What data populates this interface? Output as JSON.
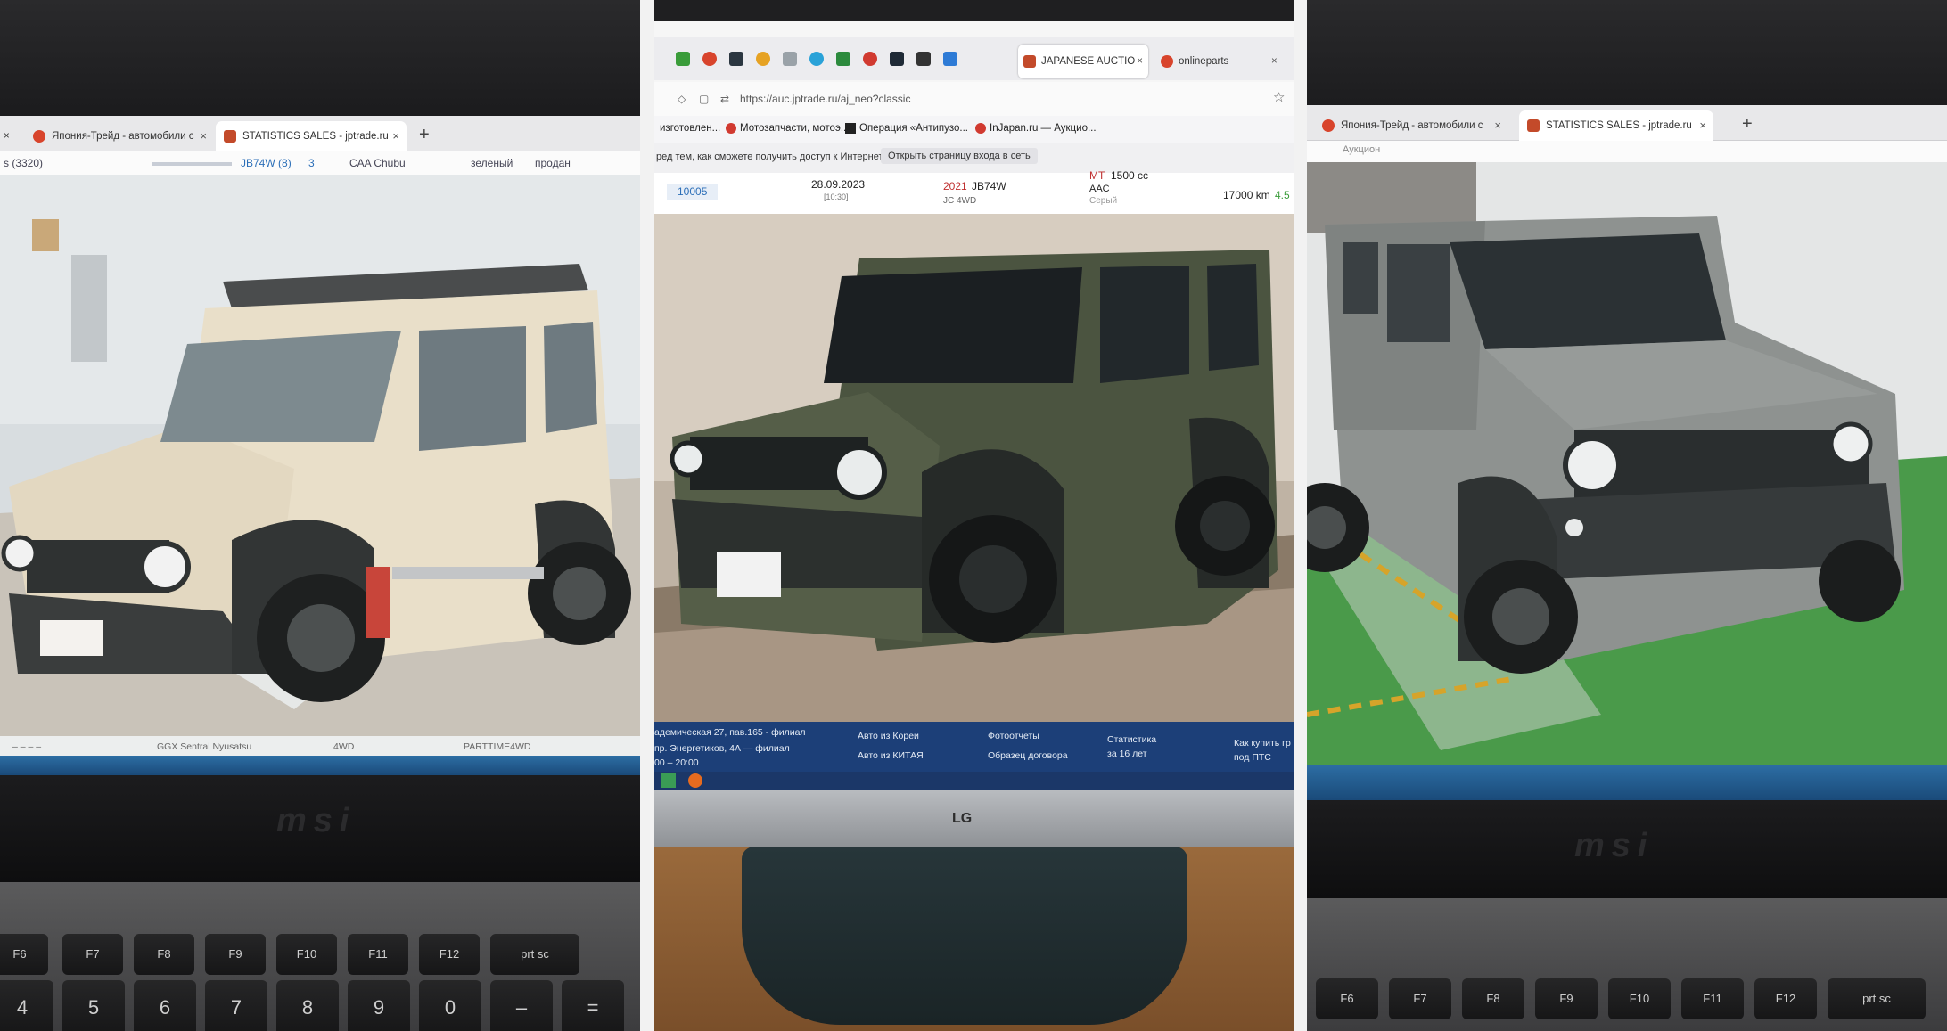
{
  "left": {
    "tabs": [
      {
        "label": "Япония-Трейд - автомобили с",
        "close": "×"
      },
      {
        "label": "STATISTICS SALES - jptrade.ru",
        "close": "×"
      }
    ],
    "new_tab": "+",
    "close_left": "×",
    "info": {
      "count": "s (3320)",
      "model": "JB74W",
      "model_count": "(8)",
      "page": "3",
      "auction": "CAA Chubu",
      "color": "зеленый",
      "status": "продан"
    },
    "footer": {
      "auction": "GGX Sentral Nyusatsu",
      "drive": "4WD",
      "transmission": "PARTTIME4WD",
      "dashes": "– – – –"
    },
    "brand": "msi",
    "keys": [
      "F6",
      "F7",
      "F8",
      "F9",
      "F10",
      "F11",
      "F12",
      "prt sc",
      "$",
      "4",
      "%",
      "5",
      "^",
      "6",
      "&",
      "7",
      "*",
      "8",
      "(",
      "9",
      ")",
      "0",
      "_",
      "–",
      "+",
      "="
    ]
  },
  "middle": {
    "browser": {
      "tab_active": "JAPANESE AUCTIO",
      "tab_other": "onlineparts",
      "url": "https://auc.jptrade.ru/aj_neo?classic",
      "bookmarks": [
        "изготовлен...",
        "Мотозапчасти, мотоэ...",
        "Операция «Антипузо...",
        "InJapan.ru — Аукцио..."
      ],
      "notice": "ред тем, как сможете получить доступ к Интернету.",
      "notice_button": "Открыть страницу входа в сеть"
    },
    "lot": {
      "number": "10005",
      "date": "28.09.2023",
      "time": "[10:30]",
      "year": "2021",
      "model": "JB74W",
      "grade": "JC 4WD",
      "transmission": "MT",
      "engine": "1500 cc",
      "ac": "AAC",
      "color_label": "Серый",
      "mileage": "17000 km",
      "score": "4.5"
    },
    "footer": {
      "addr1": "адемическая 27, пав.165 - филиал",
      "addr2": "пр. Энергетиков, 4А — филиал",
      "hours": "00 – 20:00",
      "link1": "Авто из Кореи",
      "link2": "Авто из КИТАЯ",
      "link3": "Фотоотчеты",
      "link4": "Образец договора",
      "link5": "Статистика",
      "link5b": "за 16 лет",
      "link6": "Как купить гр",
      "link6b": "под ПТС"
    },
    "brand": "LG"
  },
  "right": {
    "tabs": [
      {
        "label": "Япония-Трейд - автомобили с",
        "close": "×"
      },
      {
        "label": "STATISTICS SALES - jptrade.ru",
        "close": "×"
      }
    ],
    "new_tab": "+",
    "sub": "Аукцион",
    "brand": "msi",
    "keys": [
      "F6",
      "F7",
      "F8",
      "F9",
      "F10",
      "F11",
      "F12",
      "prt sc"
    ]
  },
  "colors": {
    "beige_car": "#e9dfc9",
    "green_car": "#4b5440",
    "grey_car": "#8e9290",
    "trim": "#2f3232"
  }
}
